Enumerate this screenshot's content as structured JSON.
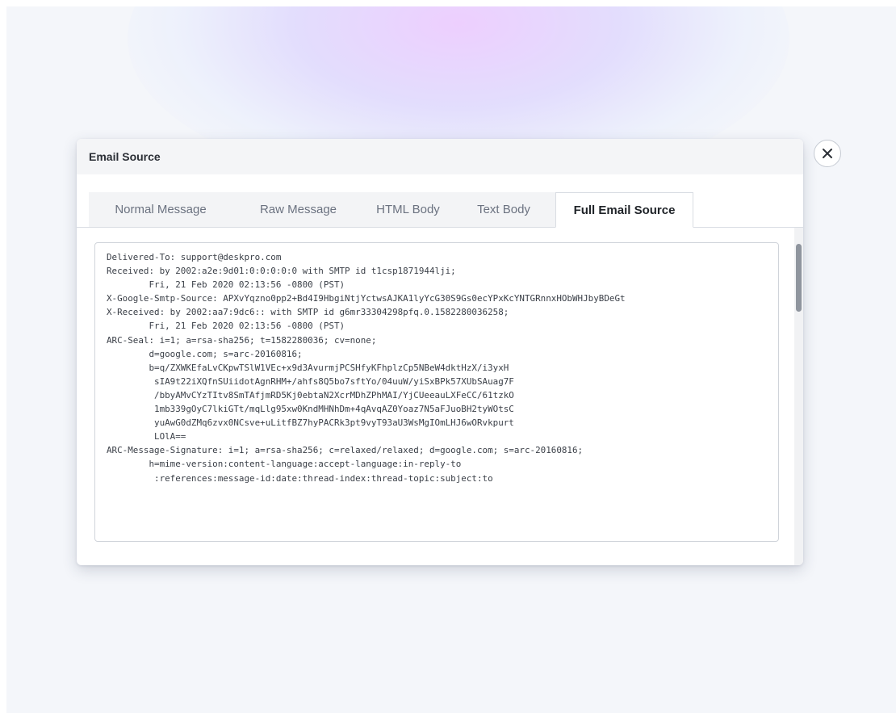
{
  "modal": {
    "title": "Email Source"
  },
  "tabs": [
    {
      "label": "Normal Message",
      "active": false
    },
    {
      "label": "Raw Message",
      "active": false
    },
    {
      "label": "HTML Body",
      "active": false
    },
    {
      "label": "Text Body",
      "active": false
    },
    {
      "label": "Full Email Source",
      "active": true
    }
  ],
  "email_source": "Delivered-To: support@deskpro.com\nReceived: by 2002:a2e:9d01:0:0:0:0:0 with SMTP id t1csp1871944lji;\n        Fri, 21 Feb 2020 02:13:56 -0800 (PST)\nX-Google-Smtp-Source: APXvYqzno0pp2+Bd4I9HbgiNtjYctwsAJKA1lyYcG30S9Gs0ecYPxKcYNTGRnnxHObWHJbyBDeGt\nX-Received: by 2002:aa7:9dc6:: with SMTP id g6mr33304298pfq.0.1582280036258;\n        Fri, 21 Feb 2020 02:13:56 -0800 (PST)\nARC-Seal: i=1; a=rsa-sha256; t=1582280036; cv=none;\n        d=google.com; s=arc-20160816;\n        b=q/ZXWKEfaLvCKpwTSlW1VEc+x9d3AvurmjPCSHfyKFhplzCp5NBeW4dktHzX/i3yxH\n         sIA9t22iXQfnSUiidotAgnRHM+/ahfs8Q5bo7sftYo/04uuW/yiSxBPk57XUbSAuag7F\n         /bbyAMvCYzTItv8SmTAfjmRD5Kj0ebtaN2XcrMDhZPhMAI/YjCUeeauLXFeCC/61tzkO\n         1mb339gOyC7lkiGTt/mqLlg95xw0KndMHNhDm+4qAvqAZ0Yoaz7N5aFJuoBH2tyWOtsC\n         yuAwG0dZMq6zvx0NCsve+uLitfBZ7hyPACRk3pt9vyT93aU3WsMgIOmLHJ6wORvkpurt\n         LOlA==\nARC-Message-Signature: i=1; a=rsa-sha256; c=relaxed/relaxed; d=google.com; s=arc-20160816;\n        h=mime-version:content-language:accept-language:in-reply-to\n         :references:message-id:date:thread-index:thread-topic:subject:to",
  "icons": {
    "close": "close-icon"
  },
  "colors": {
    "accent_glow": "#ecc8ff",
    "text_primary": "#1f2328",
    "tab_inactive_bg": "#f3f4f6"
  }
}
